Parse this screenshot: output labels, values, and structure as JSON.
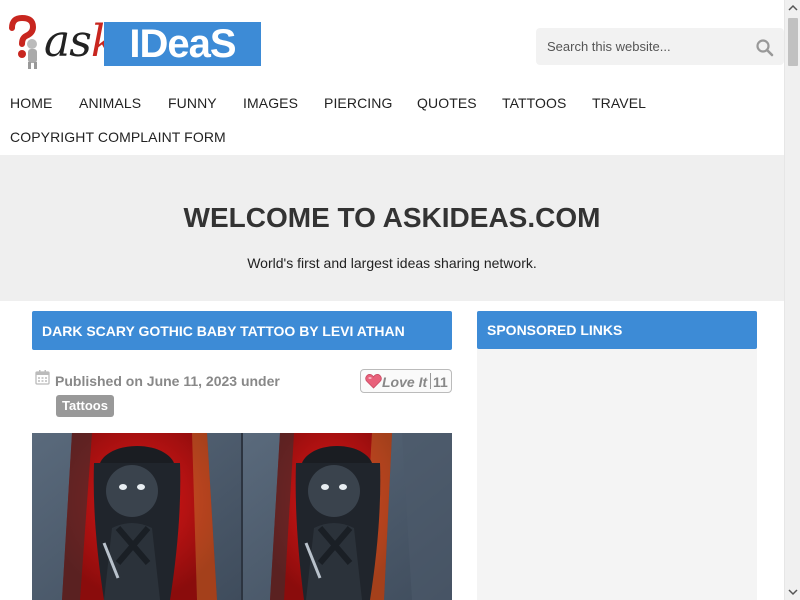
{
  "header": {
    "logo": {
      "ask_text": "as",
      "ask_k": "k",
      "ideas_text": "IDeaS"
    },
    "search": {
      "placeholder": "Search this website...",
      "icon": "search-icon"
    }
  },
  "nav": {
    "items": [
      "HOME",
      "ANIMALS",
      "FUNNY",
      "IMAGES",
      "PIERCING",
      "QUOTES",
      "TATTOOS",
      "TRAVEL",
      "COPYRIGHT COMPLAINT FORM"
    ]
  },
  "welcome": {
    "title": "WELCOME TO ASKIDEAS.COM",
    "subtitle": "World's first and largest ideas sharing network."
  },
  "post": {
    "title": "DARK SCARY GOTHIC BABY TATTOO BY LEVI ATHAN",
    "meta": "Published on June 11, 2023 under",
    "category": "Tattoos",
    "love_label": "Love It",
    "love_count": "11"
  },
  "sidebar": {
    "title": "SPONSORED LINKS"
  },
  "colors": {
    "accent": "#3d8bd6",
    "welcome_bg": "#efefef",
    "tag_bg": "#999999"
  }
}
